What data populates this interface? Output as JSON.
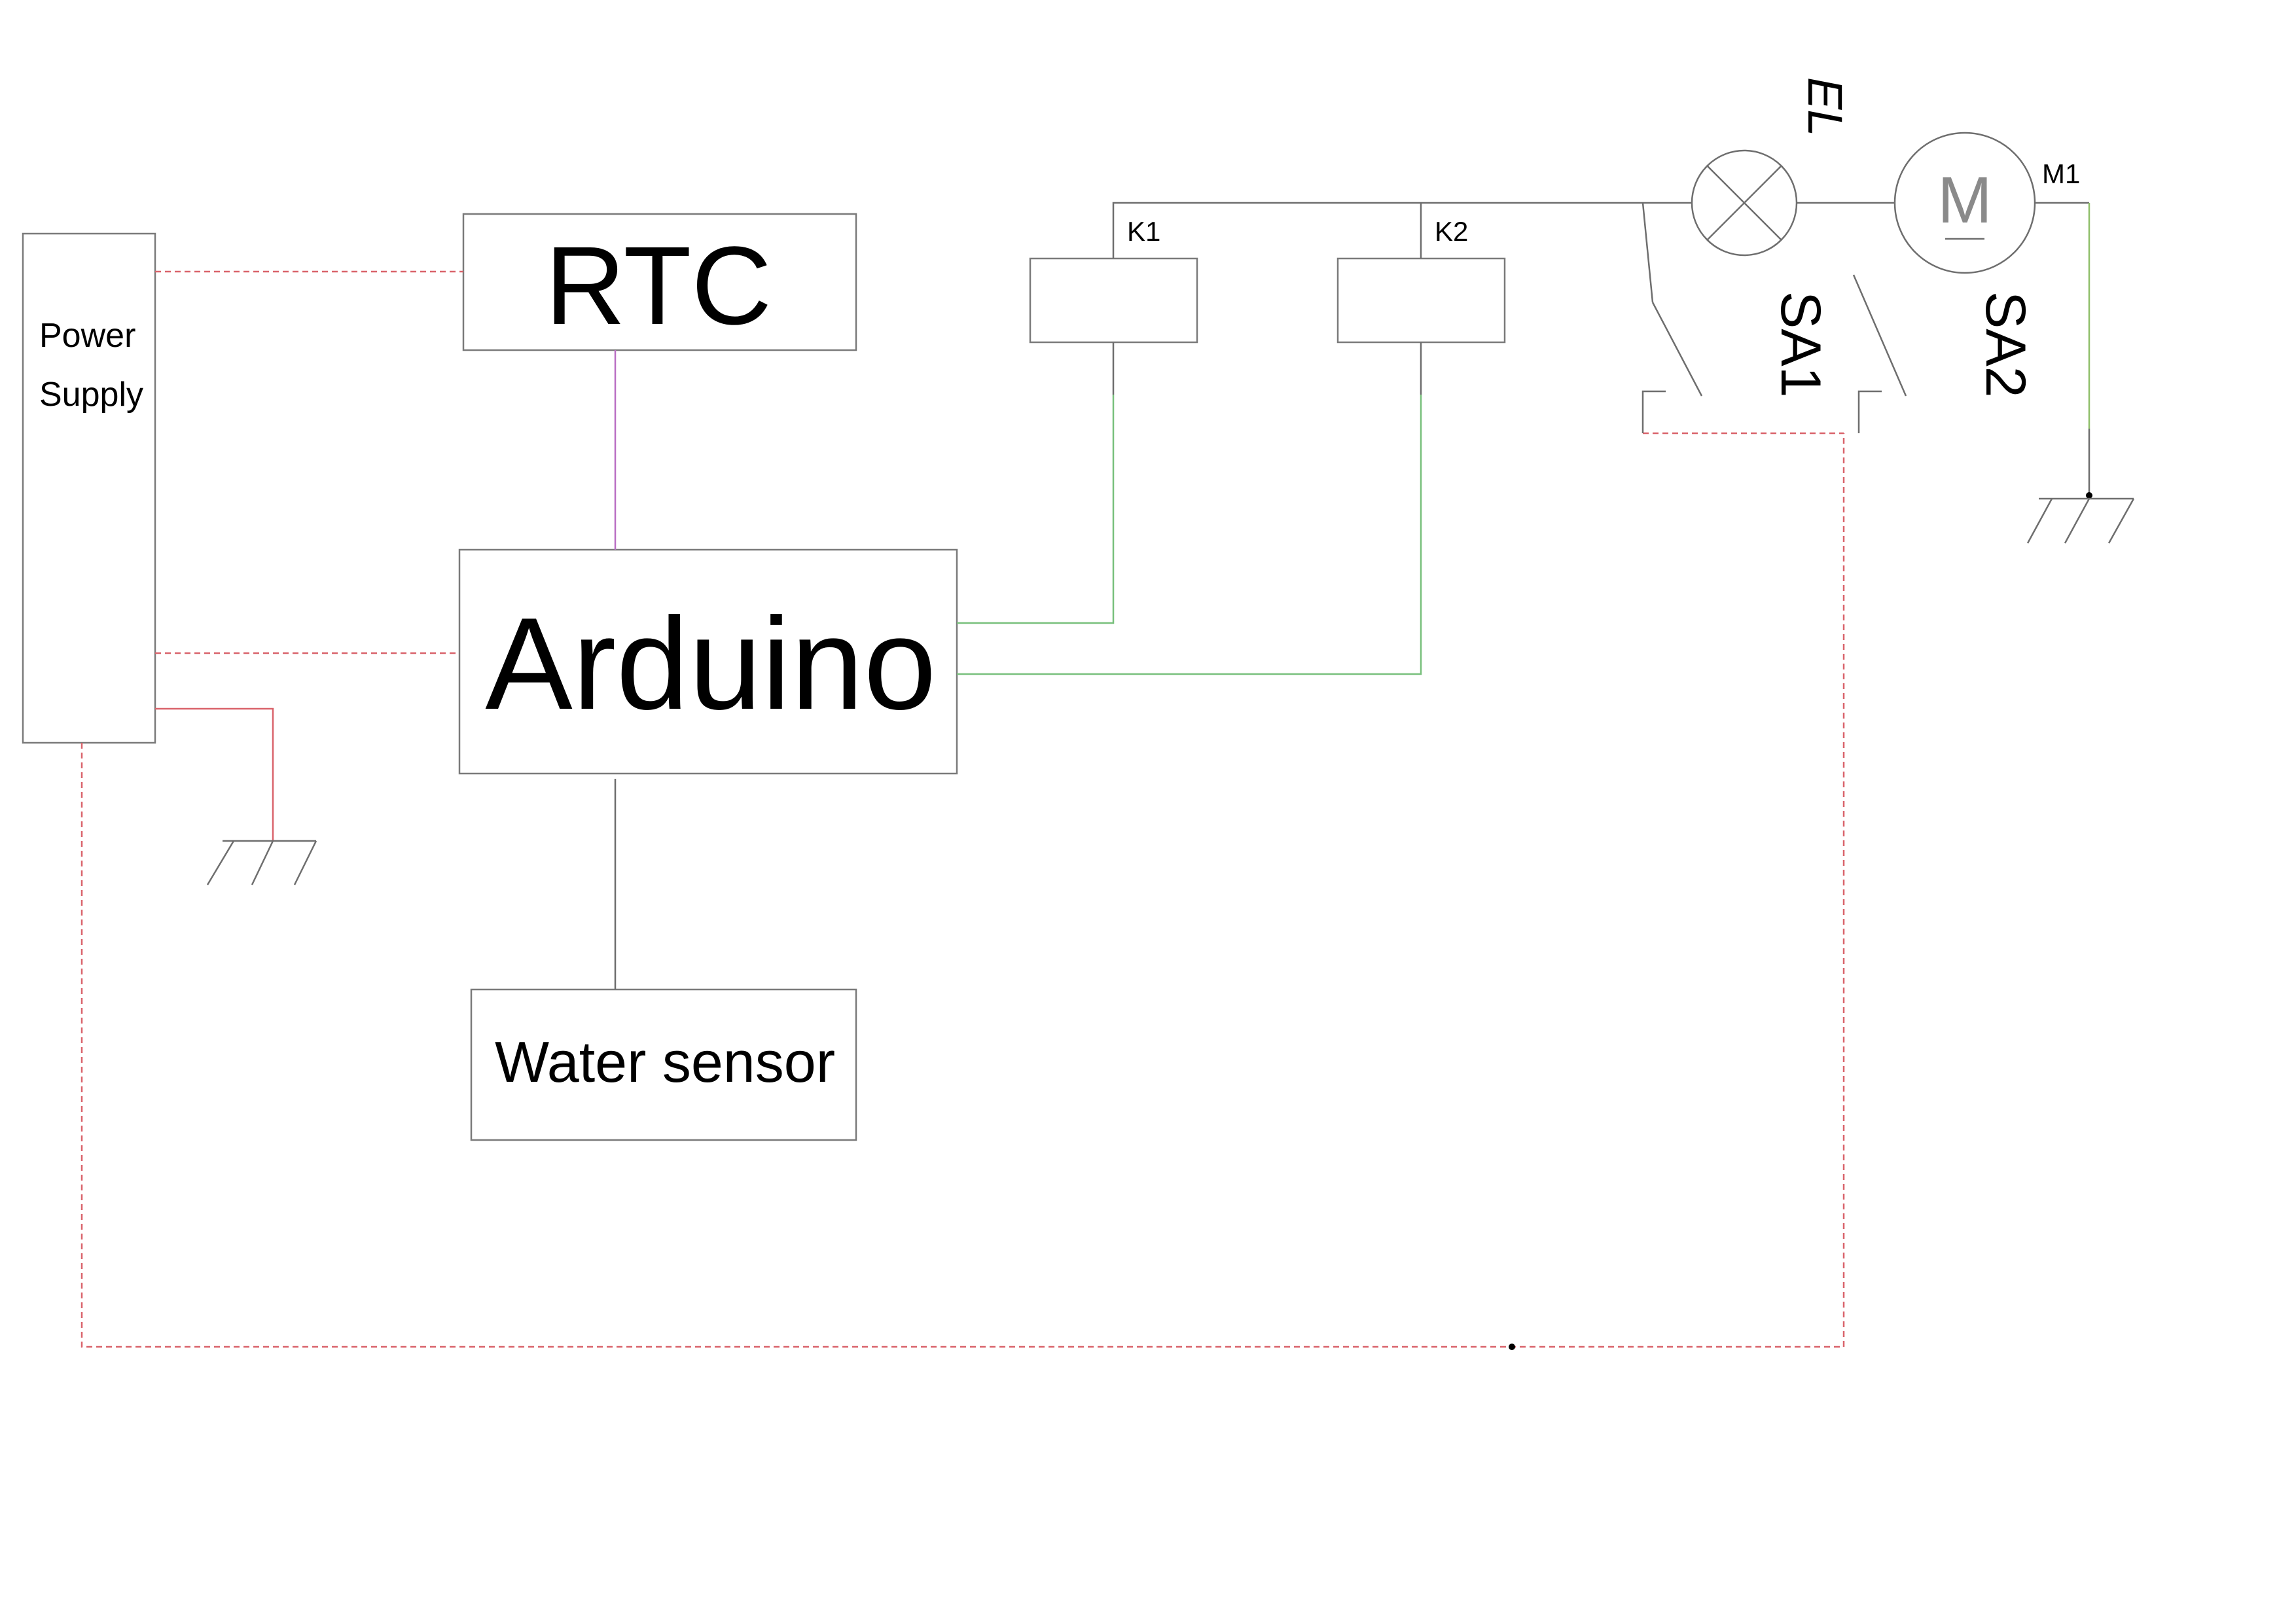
{
  "blocks": {
    "power_supply_line1": "Power",
    "power_supply_line2": "Supply",
    "rtc": "RTC",
    "arduino": "Arduino",
    "water_sensor": "Water sensor"
  },
  "relays": {
    "k1": "K1",
    "k2": "K2"
  },
  "components": {
    "lamp": "EL",
    "motor": "M1",
    "motor_symbol": "M",
    "switch1": "SA1",
    "switch2": "SA2"
  },
  "colors": {
    "power_wire": "#d9636b",
    "rtc_wire": "#b96fc4",
    "relay_control_wire": "#78c07c",
    "motor_ground_wire": "#8fbf6a",
    "outline": "#7a7a7a"
  }
}
